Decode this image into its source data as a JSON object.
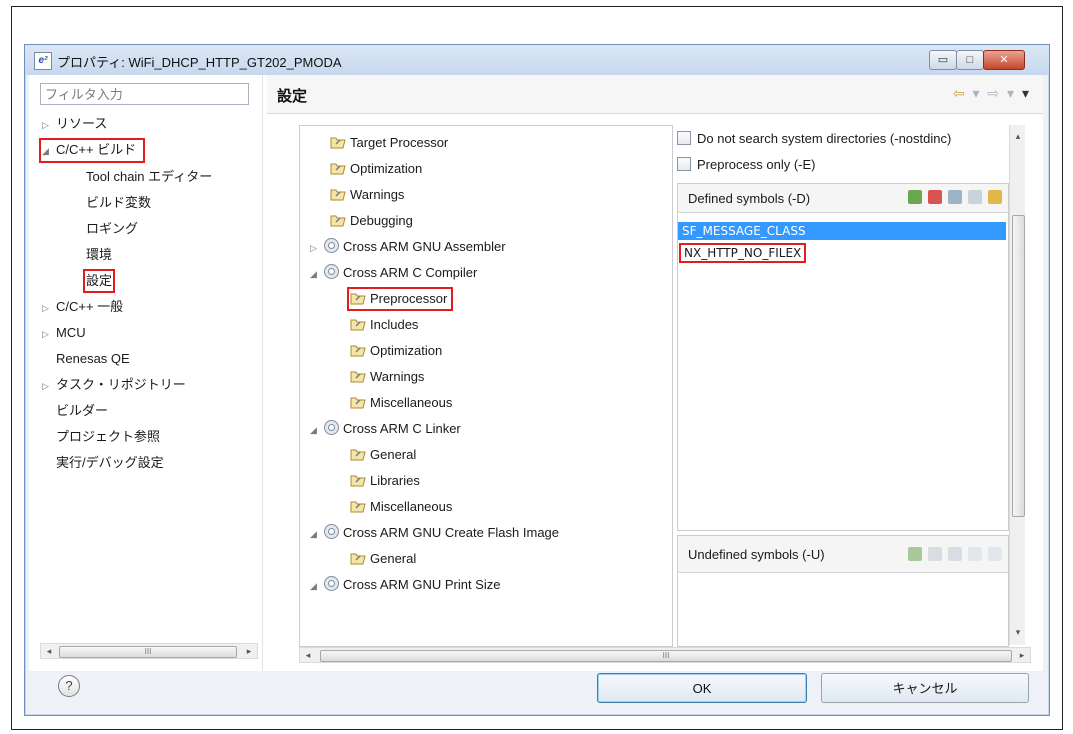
{
  "window": {
    "title": "プロパティ: WiFi_DHCP_HTTP_GT202_PMODA",
    "app_icon": "e²",
    "controls": {
      "minimize": "▭",
      "maximize": "□",
      "close": "✕"
    }
  },
  "filter": {
    "placeholder": "フィルタ入力"
  },
  "nav": {
    "items": [
      {
        "label": "リソース",
        "expander": "▷",
        "indent": 0
      },
      {
        "label": "C/C++ ビルド",
        "expander": "◢",
        "indent": 0,
        "highlighted": true
      },
      {
        "label": "Tool chain エディター",
        "indent": 1
      },
      {
        "label": "ビルド変数",
        "indent": 1
      },
      {
        "label": "ロギング",
        "indent": 1
      },
      {
        "label": "環境",
        "indent": 1
      },
      {
        "label": "設定",
        "indent": 1,
        "highlighted": true
      },
      {
        "label": "C/C++ 一般",
        "expander": "▷",
        "indent": 0
      },
      {
        "label": "MCU",
        "expander": "▷",
        "indent": 0
      },
      {
        "label": "Renesas QE",
        "indent": 0
      },
      {
        "label": "タスク・リポジトリー",
        "expander": "▷",
        "indent": 0
      },
      {
        "label": "ビルダー",
        "indent": 0
      },
      {
        "label": "プロジェクト参照",
        "indent": 0
      },
      {
        "label": "実行/デバッグ設定",
        "indent": 0
      }
    ]
  },
  "scroll_glyphs": {
    "left": "◂",
    "right": "▸",
    "up": "▴",
    "down": "▾",
    "grip": "III"
  },
  "page": {
    "title": "設定",
    "nav_arrows": {
      "back": "⇦",
      "forward": "⇨",
      "menu": "▾"
    }
  },
  "tool_tree": {
    "items": [
      {
        "label": "Target Processor",
        "type": "option"
      },
      {
        "label": "Optimization",
        "type": "option"
      },
      {
        "label": "Warnings",
        "type": "option"
      },
      {
        "label": "Debugging",
        "type": "option"
      },
      {
        "label": "Cross ARM GNU Assembler",
        "type": "tool",
        "expander": "▷"
      },
      {
        "label": "Cross ARM C Compiler",
        "type": "tool",
        "expander": "◢"
      },
      {
        "label": "Preprocessor",
        "type": "option",
        "highlighted": true
      },
      {
        "label": "Includes",
        "type": "option"
      },
      {
        "label": "Optimization",
        "type": "option"
      },
      {
        "label": "Warnings",
        "type": "option"
      },
      {
        "label": "Miscellaneous",
        "type": "option"
      },
      {
        "label": "Cross ARM C Linker",
        "type": "tool",
        "expander": "◢"
      },
      {
        "label": "General",
        "type": "option"
      },
      {
        "label": "Libraries",
        "type": "option"
      },
      {
        "label": "Miscellaneous",
        "type": "option"
      },
      {
        "label": "Cross ARM GNU Create Flash Image",
        "type": "tool",
        "expander": "◢"
      },
      {
        "label": "General",
        "type": "option"
      },
      {
        "label": "Cross ARM GNU Print Size",
        "type": "tool",
        "expander": "◢"
      }
    ]
  },
  "settings": {
    "nostdinc_label": "Do not search system directories (-nostdinc)",
    "preprocess_only_label": "Preprocess only (-E)",
    "defined": {
      "label": "Defined symbols (-D)",
      "symbols": [
        "SF_MESSAGE_CLASS",
        "NX_HTTP_NO_FILEX"
      ]
    },
    "undefined": {
      "label": "Undefined symbols (-U)"
    }
  },
  "buttons": {
    "help": "?",
    "ok": "OK",
    "cancel": "キャンセル"
  },
  "colors": {
    "highlight": "#e21d1d",
    "selection": "#3399ff",
    "accent": "#caa238"
  }
}
